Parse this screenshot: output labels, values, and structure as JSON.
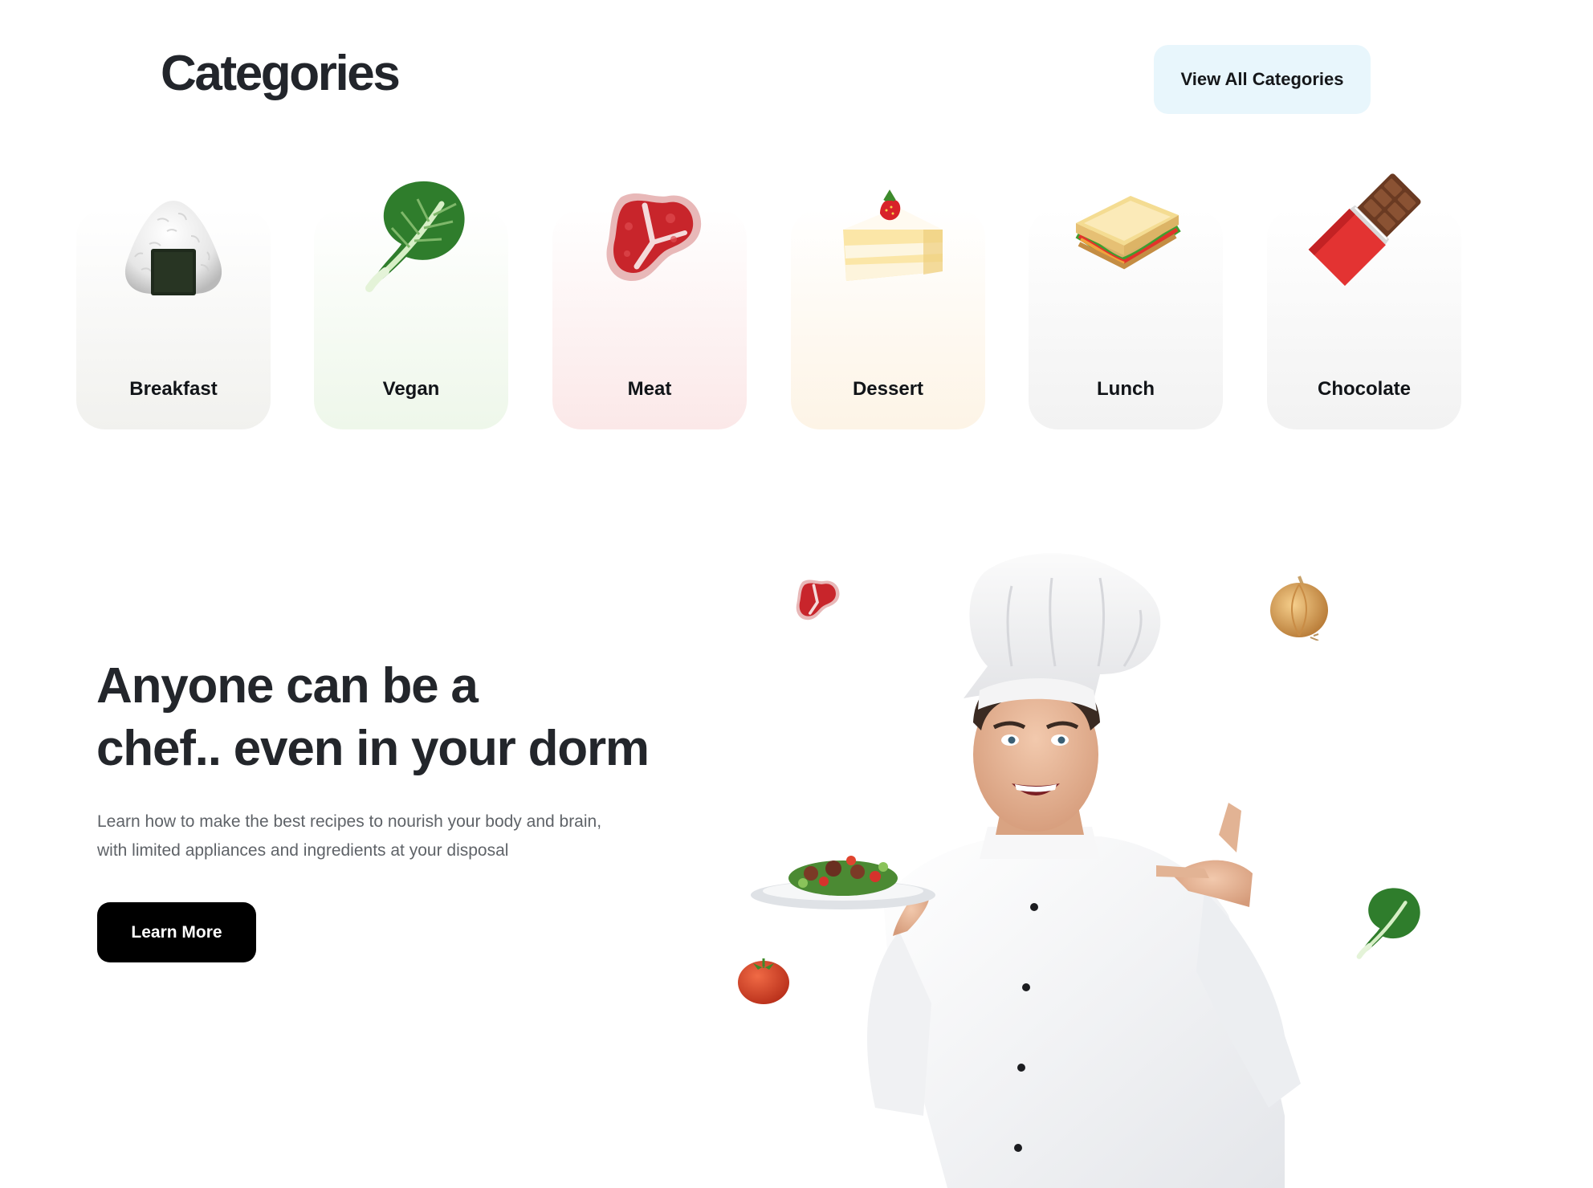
{
  "categories_section": {
    "title": "Categories",
    "view_all_label": "View All Categories",
    "items": [
      {
        "label": "Breakfast",
        "icon": "rice-ball-icon",
        "tint": "#f1f1ee"
      },
      {
        "label": "Vegan",
        "icon": "leafy-green-icon",
        "tint": "#eef7ea"
      },
      {
        "label": "Meat",
        "icon": "steak-icon",
        "tint": "#fbe8e8"
      },
      {
        "label": "Dessert",
        "icon": "cake-slice-icon",
        "tint": "#fdf4e6"
      },
      {
        "label": "Lunch",
        "icon": "sandwich-icon",
        "tint": "#f2f2f2"
      },
      {
        "label": "Chocolate",
        "icon": "chocolate-bar-icon",
        "tint": "#f2f2f2"
      }
    ]
  },
  "hero": {
    "title_line1": "Anyone can be a",
    "title_line2": "chef.. even in your dorm",
    "description_line1": "Learn how to make the best recipes to nourish your body and brain,",
    "description_line2": "with limited appliances and ingredients at your disposal",
    "cta_label": "Learn More",
    "illustration": "chef-holding-salad-plate",
    "floating_icons": [
      "steak-icon",
      "onion-icon",
      "tomato-icon",
      "leafy-green-icon"
    ]
  },
  "colors": {
    "view_all_bg": "#e8f6fc",
    "cta_bg": "#000000",
    "heading": "#23262b",
    "body_text": "#5f6368"
  }
}
